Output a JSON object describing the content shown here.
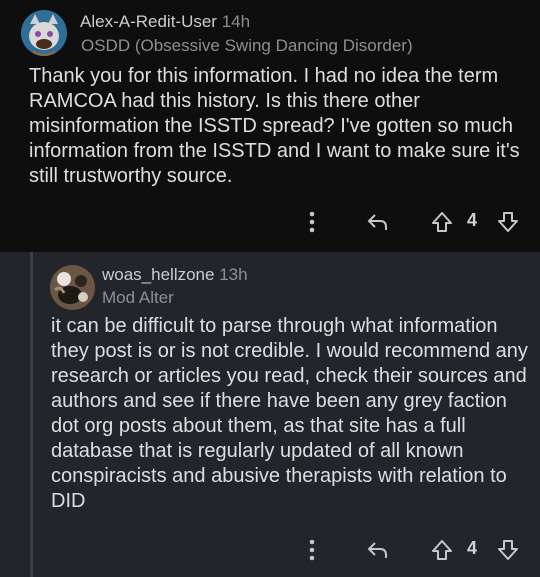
{
  "comments": [
    {
      "username": "Alex-A-Redit-User",
      "time": "14h",
      "flair": "OSDD (Obsessive Swing Dancing Disorder)",
      "body": "Thank you for this information. I had no idea the term RAMCOA had this history. Is this there other misinformation the ISSTD spread? I've gotten so much information from the ISSTD and I want to make sure it's still trustworthy source.",
      "score": "4",
      "icons": {
        "more": "more-vertical-icon",
        "reply": "reply-arrow-icon",
        "upvote": "upvote-arrow-icon",
        "downvote": "downvote-arrow-icon"
      }
    },
    {
      "username": "woas_hellzone",
      "time": "13h",
      "flair": "Mod Alter",
      "body": "it can be difficult to parse through what information they post is or is not credible. I would recommend any research or articles you read, check their sources and authors and see if there have been any grey faction dot org posts about them, as that site has a full database that is regularly updated of all known conspiracists and abusive therapists with relation to DID",
      "score": "4",
      "icons": {
        "more": "more-vertical-icon",
        "reply": "reply-arrow-icon",
        "upvote": "upvote-arrow-icon",
        "downvote": "downvote-arrow-icon"
      }
    }
  ],
  "colors": {
    "page_bg": "#0e0e0e",
    "reply_bg": "#22262b",
    "icon": "#c4c8cc"
  }
}
